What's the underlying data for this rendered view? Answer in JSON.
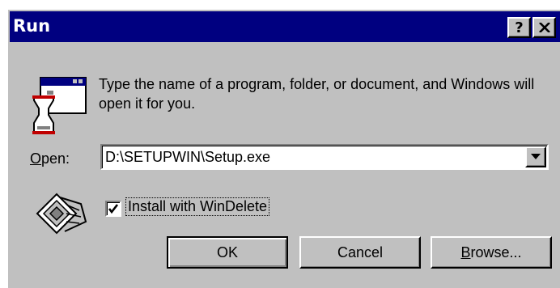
{
  "window": {
    "title": "Run",
    "help_button": "?",
    "close_button": "×"
  },
  "message": "Type the name of a program, folder, or document, and Windows will open it for you.",
  "open": {
    "label_accel": "O",
    "label_rest": "pen:",
    "value": "D:\\SETUPWIN\\Setup.exe"
  },
  "install_checkbox": {
    "checked": true,
    "label": "Install with WinDelete"
  },
  "buttons": {
    "ok": "OK",
    "cancel": "Cancel",
    "browse_accel": "B",
    "browse_rest": "rowse..."
  },
  "icons": {
    "run": "run-program-icon",
    "setup": "windelete-setup-icon"
  },
  "colors": {
    "titlebar": "#000080",
    "face": "#c0c0c0"
  }
}
